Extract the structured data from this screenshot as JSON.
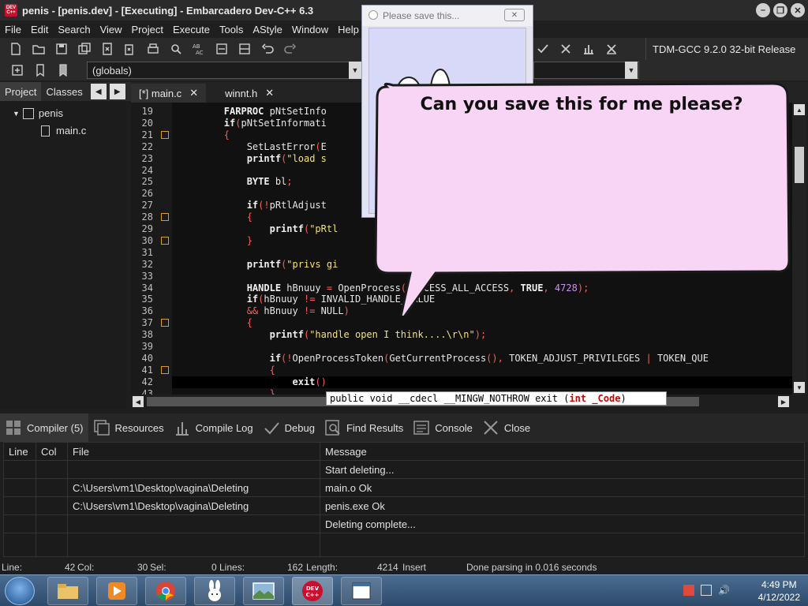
{
  "window": {
    "title": "penis - [penis.dev] - [Executing] - Embarcadero Dev-C++ 6.3",
    "app_icon_text": "DEV C++"
  },
  "menu": [
    "File",
    "Edit",
    "Search",
    "View",
    "Project",
    "Execute",
    "Tools",
    "AStyle",
    "Window",
    "Help"
  ],
  "toolbar": {
    "compiler": "TDM-GCC 9.2.0 32-bit Release"
  },
  "scope_select": {
    "value": "(globals)"
  },
  "left_panel": {
    "tabs": [
      "Project",
      "Classes"
    ],
    "tree": {
      "project": "penis",
      "file": "main.c"
    }
  },
  "editor": {
    "tabs": [
      {
        "label": "[*] main.c"
      },
      {
        "label": "winnt.h"
      }
    ],
    "line_numbers": [
      "19",
      "20",
      "21",
      "22",
      "23",
      "24",
      "25",
      "26",
      "27",
      "28",
      "29",
      "30",
      "31",
      "32",
      "33",
      "34",
      "35",
      "36",
      "37",
      "38",
      "39",
      "40",
      "41",
      "42",
      "43"
    ],
    "code_lines": [
      "        FARPROC pNtSetInfo",
      "        if(pNtSetInformati",
      "        {",
      "            SetLastError(E",
      "            printf(\"load s",
      "",
      "            BYTE bl;",
      "",
      "            if(!pRtlAdjust",
      "            {",
      "                printf(\"pRtl",
      "            }",
      "",
      "            printf(\"privs gi",
      "",
      "            HANDLE hBnuuy = OpenProcess(PROCESS_ALL_ACCESS, TRUE, 4728);",
      "            if(hBnuuy != INVALID_HANDLE_VALUE",
      "            && hBnuuy != NULL)",
      "            {",
      "                printf(\"handle open I think....\\r\\n\");",
      "",
      "                if(!OpenProcessToken(GetCurrentProcess(), TOKEN_ADJUST_PRIVILEGES | TOKEN_QUE",
      "                {",
      "                    exit()",
      "                }"
    ],
    "tooltip": "public void __cdecl __MINGW_NOTHROW exit (int _Code)"
  },
  "bottom_tabs": [
    {
      "label": "Compiler (5)",
      "icon": "grid-icon"
    },
    {
      "label": "Resources",
      "icon": "resources-icon"
    },
    {
      "label": "Compile Log",
      "icon": "chart-icon"
    },
    {
      "label": "Debug",
      "icon": "check-icon"
    },
    {
      "label": "Find Results",
      "icon": "find-icon"
    },
    {
      "label": "Console",
      "icon": "console-icon"
    },
    {
      "label": "Close",
      "icon": "close-icon"
    }
  ],
  "messages": {
    "headers": {
      "line": "Line",
      "col": "Col",
      "file": "File",
      "message": "Message"
    },
    "rows": [
      {
        "file": "",
        "message": "Start deleting..."
      },
      {
        "file": "C:\\Users\\vm1\\Desktop\\vagina\\Deleting",
        "message": "main.o Ok"
      },
      {
        "file": "C:\\Users\\vm1\\Desktop\\vagina\\Deleting",
        "message": "penis.exe Ok"
      },
      {
        "file": "",
        "message": "Deleting complete..."
      }
    ]
  },
  "status": {
    "line_label": "Line:",
    "line": "42",
    "col_label": "Col:",
    "col": "30",
    "sel_label": "Sel:",
    "sel": "0",
    "lines_label": "Lines:",
    "lines": "162",
    "length_label": "Length:",
    "length": "4214",
    "mode": "Insert",
    "parse": "Done parsing in 0.016 seconds"
  },
  "popup": {
    "title": "Please save this...",
    "close_symbol": "✕",
    "speech": "Can you save this for me please?"
  },
  "taskbar": {
    "time": "4:49 PM",
    "date": "4/12/2022"
  }
}
